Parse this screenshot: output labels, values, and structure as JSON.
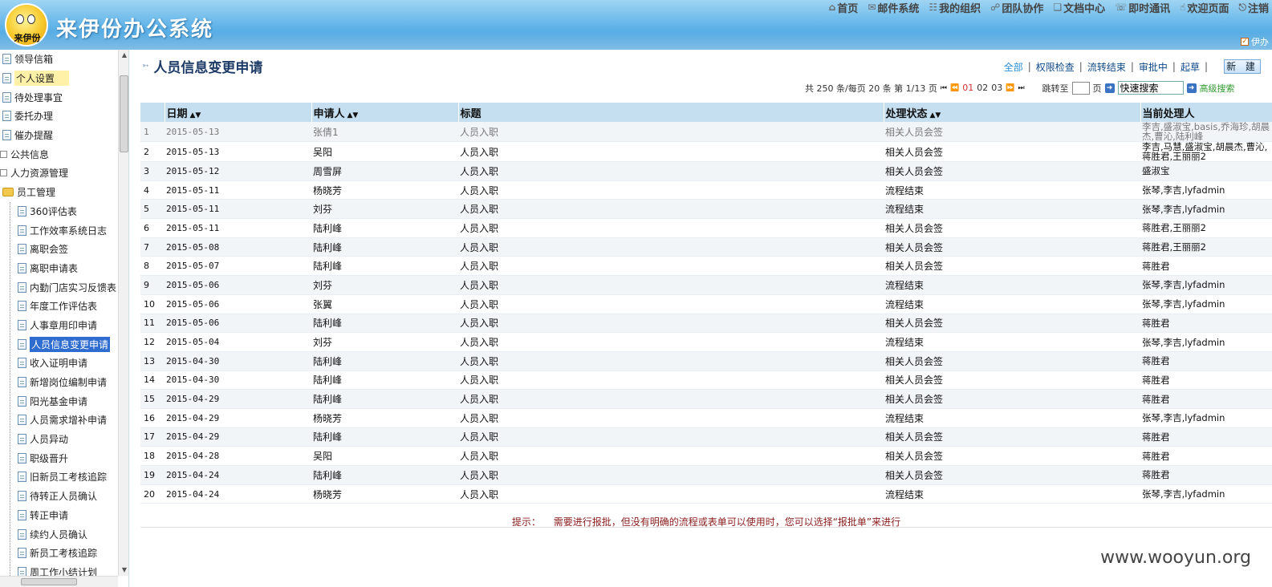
{
  "app": {
    "title": "来伊份办公系统",
    "logo_text": "来伊份",
    "user_badge": "伊办"
  },
  "topnav": [
    {
      "label": "首页",
      "icon": "home-icon"
    },
    {
      "label": "邮件系统",
      "icon": "mail-icon"
    },
    {
      "label": "我的组织",
      "icon": "org-icon"
    },
    {
      "label": "团队协作",
      "icon": "team-icon"
    },
    {
      "label": "文档中心",
      "icon": "doc-icon"
    },
    {
      "label": "即时通讯",
      "icon": "chat-icon"
    },
    {
      "label": "欢迎页面",
      "icon": "hand-icon"
    },
    {
      "label": "注销",
      "icon": "logout-icon"
    }
  ],
  "sidebar": {
    "items": [
      {
        "label": "领导信箱",
        "level": 0,
        "icon": "page"
      },
      {
        "label": "个人设置",
        "level": 0,
        "icon": "page",
        "state": "highlight"
      },
      {
        "label": "待处理事宜",
        "level": 0,
        "icon": "page"
      },
      {
        "label": "委托办理",
        "level": 0,
        "icon": "page"
      },
      {
        "label": "催办提醒",
        "level": 0,
        "icon": "page"
      },
      {
        "label": "公共信息",
        "level": -1,
        "icon": "node"
      },
      {
        "label": "人力资源管理",
        "level": -1,
        "icon": "node"
      },
      {
        "label": "员工管理",
        "level": 0,
        "icon": "folder"
      },
      {
        "label": "360评估表",
        "level": 1,
        "icon": "page"
      },
      {
        "label": "工作效率系统日志",
        "level": 1,
        "icon": "page"
      },
      {
        "label": "离职会签",
        "level": 1,
        "icon": "page"
      },
      {
        "label": "离职申请表",
        "level": 1,
        "icon": "page"
      },
      {
        "label": "内勤门店实习反馈表",
        "level": 1,
        "icon": "page"
      },
      {
        "label": "年度工作评估表",
        "level": 1,
        "icon": "page"
      },
      {
        "label": "人事章用印申请",
        "level": 1,
        "icon": "page"
      },
      {
        "label": "人员信息变更申请",
        "level": 1,
        "icon": "page",
        "state": "active"
      },
      {
        "label": "收入证明申请",
        "level": 1,
        "icon": "page"
      },
      {
        "label": "新增岗位编制申请",
        "level": 1,
        "icon": "page"
      },
      {
        "label": "阳光基金申请",
        "level": 1,
        "icon": "page"
      },
      {
        "label": "人员需求增补申请",
        "level": 1,
        "icon": "page"
      },
      {
        "label": "人员异动",
        "level": 1,
        "icon": "page"
      },
      {
        "label": "职级晋升",
        "level": 1,
        "icon": "page"
      },
      {
        "label": "旧新员工考核追踪",
        "level": 1,
        "icon": "page"
      },
      {
        "label": "待转正人员确认",
        "level": 1,
        "icon": "page"
      },
      {
        "label": "转正申请",
        "level": 1,
        "icon": "page"
      },
      {
        "label": "续约人员确认",
        "level": 1,
        "icon": "page"
      },
      {
        "label": "新员工考核追踪",
        "level": 1,
        "icon": "page"
      },
      {
        "label": "周工作小结计划",
        "level": 1,
        "icon": "page"
      }
    ]
  },
  "main": {
    "page_title": "人员信息变更申请",
    "filters": [
      "全部",
      "权限检查",
      "流转结束",
      "审批中",
      "起草"
    ],
    "new_button": "新 建",
    "pager": {
      "total_text": "共 250 条/每页 20 条  第 1/13 页",
      "pages": [
        "01",
        "02",
        "03"
      ],
      "current_page": "01",
      "jump_label": "跳转至",
      "page_unit": "页",
      "search_placeholder": "快速搜索",
      "adv_search": "高级搜索"
    },
    "columns": [
      "",
      "日期",
      "申请人",
      "标题",
      "处理状态",
      "当前处理人"
    ],
    "rows": [
      {
        "no": "1",
        "date": "2015-05-13",
        "applicant": "张倩1",
        "title": "人员入职",
        "status": "相关人员会签",
        "handler": "李吉,盛淑宝,basis,乔海珍,胡晨杰,曹沁,陆利峰"
      },
      {
        "no": "2",
        "date": "2015-05-13",
        "applicant": "吴阳",
        "title": "人员入职",
        "status": "相关人员会签",
        "handler": "李吉,马慧,盛淑宝,胡晨杰,曹沁,蒋胜君,王丽丽2"
      },
      {
        "no": "3",
        "date": "2015-05-12",
        "applicant": "周雪屏",
        "title": "人员入职",
        "status": "相关人员会签",
        "handler": "盛淑宝"
      },
      {
        "no": "4",
        "date": "2015-05-11",
        "applicant": "杨晓芳",
        "title": "人员入职",
        "status": "流程结束",
        "handler": "张琴,李吉,lyfadmin"
      },
      {
        "no": "5",
        "date": "2015-05-11",
        "applicant": "刘芬",
        "title": "人员入职",
        "status": "流程结束",
        "handler": "张琴,李吉,lyfadmin"
      },
      {
        "no": "6",
        "date": "2015-05-11",
        "applicant": "陆利峰",
        "title": "人员入职",
        "status": "相关人员会签",
        "handler": "蒋胜君,王丽丽2"
      },
      {
        "no": "7",
        "date": "2015-05-08",
        "applicant": "陆利峰",
        "title": "人员入职",
        "status": "相关人员会签",
        "handler": "蒋胜君,王丽丽2"
      },
      {
        "no": "8",
        "date": "2015-05-07",
        "applicant": "陆利峰",
        "title": "人员入职",
        "status": "相关人员会签",
        "handler": "蒋胜君"
      },
      {
        "no": "9",
        "date": "2015-05-06",
        "applicant": "刘芬",
        "title": "人员入职",
        "status": "流程结束",
        "handler": "张琴,李吉,lyfadmin"
      },
      {
        "no": "10",
        "date": "2015-05-06",
        "applicant": "张翼",
        "title": "人员入职",
        "status": "流程结束",
        "handler": "张琴,李吉,lyfadmin"
      },
      {
        "no": "11",
        "date": "2015-05-06",
        "applicant": "陆利峰",
        "title": "人员入职",
        "status": "相关人员会签",
        "handler": "蒋胜君"
      },
      {
        "no": "12",
        "date": "2015-05-04",
        "applicant": "刘芬",
        "title": "人员入职",
        "status": "流程结束",
        "handler": "张琴,李吉,lyfadmin"
      },
      {
        "no": "13",
        "date": "2015-04-30",
        "applicant": "陆利峰",
        "title": "人员入职",
        "status": "相关人员会签",
        "handler": "蒋胜君"
      },
      {
        "no": "14",
        "date": "2015-04-30",
        "applicant": "陆利峰",
        "title": "人员入职",
        "status": "相关人员会签",
        "handler": "蒋胜君"
      },
      {
        "no": "15",
        "date": "2015-04-29",
        "applicant": "陆利峰",
        "title": "人员入职",
        "status": "相关人员会签",
        "handler": "蒋胜君"
      },
      {
        "no": "16",
        "date": "2015-04-29",
        "applicant": "杨晓芳",
        "title": "人员入职",
        "status": "流程结束",
        "handler": "张琴,李吉,lyfadmin"
      },
      {
        "no": "17",
        "date": "2015-04-29",
        "applicant": "陆利峰",
        "title": "人员入职",
        "status": "相关人员会签",
        "handler": "蒋胜君"
      },
      {
        "no": "18",
        "date": "2015-04-28",
        "applicant": "吴阳",
        "title": "人员入职",
        "status": "相关人员会签",
        "handler": "蒋胜君"
      },
      {
        "no": "19",
        "date": "2015-04-24",
        "applicant": "陆利峰",
        "title": "人员入职",
        "status": "相关人员会签",
        "handler": "蒋胜君"
      },
      {
        "no": "20",
        "date": "2015-04-24",
        "applicant": "杨晓芳",
        "title": "人员入职",
        "status": "流程结束",
        "handler": "张琴,李吉,lyfadmin"
      }
    ],
    "hint_label": "提示：",
    "hint_text": "需要进行报批，但没有明确的流程或表单可以使用时，您可以选择“报批单”来进行"
  },
  "watermark": "www.wooyun.org",
  "colors": {
    "header_top": "#9fd4f3",
    "header_bottom": "#3f9bd9",
    "table_header": "#c5dff0",
    "active_item": "#2f6ccf",
    "hint_text": "#8b1c1c"
  }
}
